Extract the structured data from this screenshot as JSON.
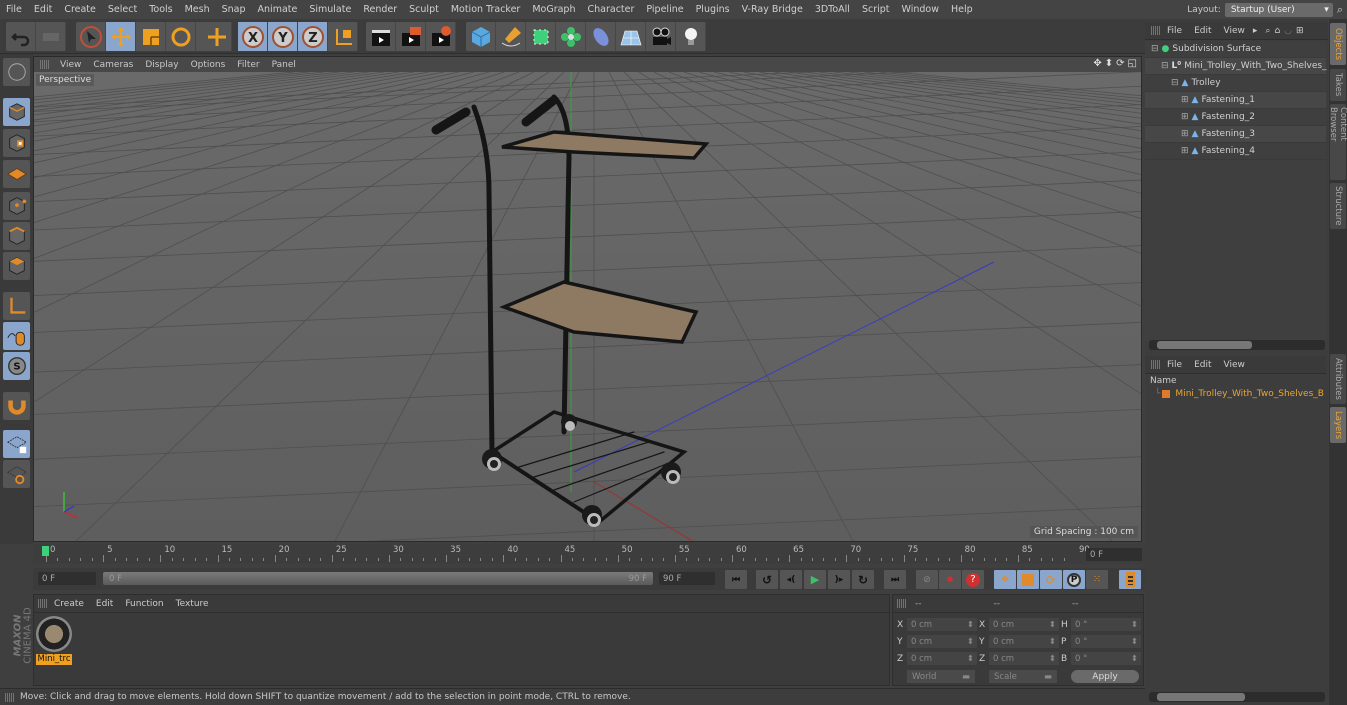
{
  "menubar": {
    "items": [
      "File",
      "Edit",
      "Create",
      "Select",
      "Tools",
      "Mesh",
      "Snap",
      "Animate",
      "Simulate",
      "Render",
      "Sculpt",
      "Motion Tracker",
      "MoGraph",
      "Character",
      "Pipeline",
      "Plugins",
      "V-Ray Bridge",
      "3DToAll",
      "Script",
      "Window",
      "Help"
    ],
    "layout_label": "Layout:",
    "layout_value": "Startup (User)"
  },
  "toolbar": {
    "tools": [
      "undo-icon",
      "redo-icon",
      "live-selection-icon",
      "move-icon",
      "scale-icon",
      "rotate-icon",
      "add-object-icon",
      "x-axis-icon",
      "y-axis-icon",
      "z-axis-icon",
      "world-coordinates-icon",
      "render-view-icon",
      "render-to-picture-viewer-icon",
      "render-settings-icon",
      "cube-icon",
      "pen-icon",
      "subdivision-icon",
      "cloner-icon",
      "deformer-icon",
      "floor-icon",
      "camera-icon",
      "light-icon"
    ]
  },
  "viewport": {
    "menu": [
      "View",
      "Cameras",
      "Display",
      "Options",
      "Filter",
      "Panel"
    ],
    "camera_label": "Perspective",
    "grid_spacing": "Grid Spacing : 100 cm"
  },
  "objects_panel": {
    "menu": [
      "File",
      "Edit",
      "View"
    ],
    "tree": [
      {
        "name": "Subdivision Surface",
        "depth": 0,
        "icon": "subdivision-icon"
      },
      {
        "name": "Mini_Trolley_With_Two_Shelves_",
        "depth": 1,
        "icon": "layer-null-icon"
      },
      {
        "name": "Trolley",
        "depth": 2,
        "icon": "polygon-icon"
      },
      {
        "name": "Fastening_1",
        "depth": 3,
        "icon": "polygon-icon"
      },
      {
        "name": "Fastening_2",
        "depth": 3,
        "icon": "polygon-icon"
      },
      {
        "name": "Fastening_3",
        "depth": 3,
        "icon": "polygon-icon"
      },
      {
        "name": "Fastening_4",
        "depth": 3,
        "icon": "polygon-icon"
      }
    ]
  },
  "right_tabs_top": [
    "Objects",
    "Takes",
    "Content Browser",
    "Structure"
  ],
  "right_tabs_bottom": [
    "Attributes",
    "Layers"
  ],
  "layers_panel": {
    "menu": [
      "File",
      "Edit",
      "View"
    ],
    "column_header": "Name",
    "layers": [
      {
        "name": "Mini_Trolley_With_Two_Shelves_B",
        "color": "#e07a2a"
      }
    ]
  },
  "timeline": {
    "ticks": [
      "0",
      "5",
      "10",
      "15",
      "20",
      "25",
      "30",
      "35",
      "40",
      "45",
      "50",
      "55",
      "60",
      "65",
      "70",
      "75",
      "80",
      "85",
      "90"
    ],
    "current_frame_field": "0 F",
    "start_field": "0 F",
    "range_start": "0 F",
    "range_end": "90 F",
    "end_field": "90 F"
  },
  "playback": {
    "buttons": [
      "go-to-start-icon",
      "previous-key-icon",
      "previous-frame-icon",
      "play-icon",
      "next-frame-icon",
      "next-key-icon",
      "go-to-end-icon",
      "record-icon",
      "autokey-icon",
      "keyframe-selection-icon",
      "position-key-icon",
      "scale-key-icon",
      "rotation-key-icon",
      "parameter-key-icon",
      "pla-key-icon",
      "timeline-icon"
    ]
  },
  "material_panel": {
    "menu": [
      "Create",
      "Edit",
      "Function",
      "Texture"
    ],
    "materials": [
      {
        "name": "Mini_trc"
      }
    ]
  },
  "coordinates": {
    "headers": [
      "--",
      "--",
      "--"
    ],
    "rows": [
      {
        "l1": "X",
        "v1": "0 cm",
        "l2": "X",
        "v2": "0 cm",
        "l3": "H",
        "v3": "0 °"
      },
      {
        "l1": "Y",
        "v1": "0 cm",
        "l2": "Y",
        "v2": "0 cm",
        "l3": "P",
        "v3": "0 °"
      },
      {
        "l1": "Z",
        "v1": "0 cm",
        "l2": "Z",
        "v2": "0 cm",
        "l3": "B",
        "v3": "0 °"
      }
    ],
    "space_select": "World",
    "mode_select": "Scale",
    "apply_label": "Apply"
  },
  "brand": {
    "line1": "MAXON",
    "line2": "CINEMA 4D"
  },
  "status": "Move: Click and drag to move elements. Hold down SHIFT to quantize movement / add to the selection in point mode, CTRL to remove."
}
